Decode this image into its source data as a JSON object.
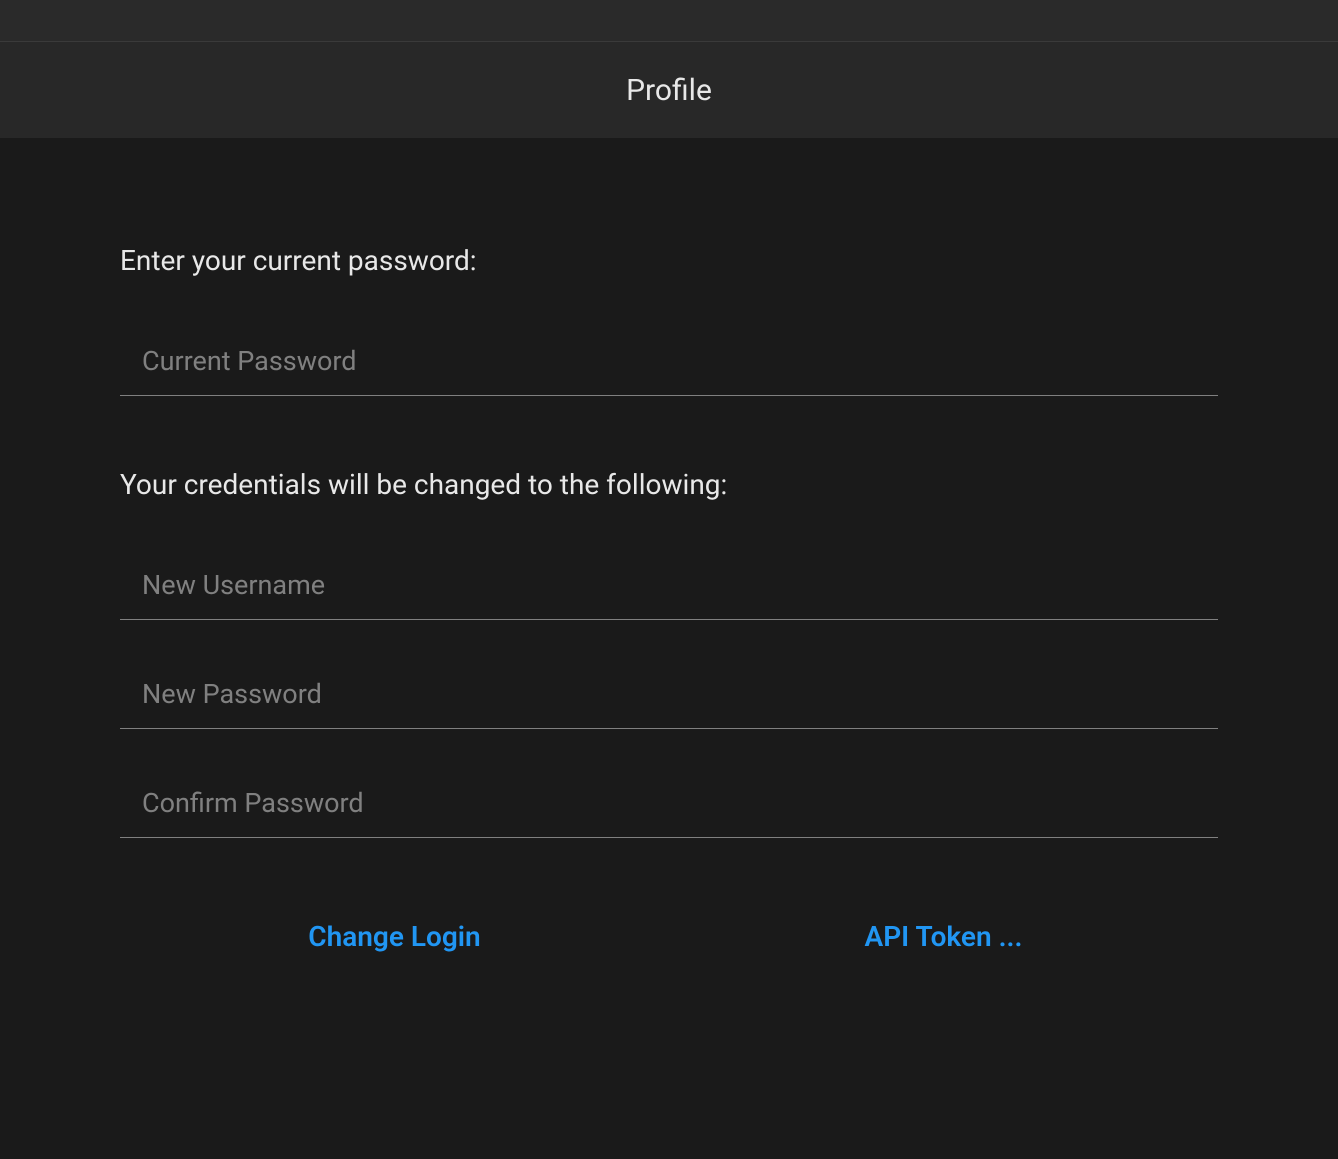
{
  "header": {
    "title": "Profile"
  },
  "form": {
    "current_password_label": "Enter your current password:",
    "current_password_placeholder": "Current Password",
    "new_credentials_label": "Your credentials will be changed to the following:",
    "new_username_placeholder": "New Username",
    "new_password_placeholder": "New Password",
    "confirm_password_placeholder": "Confirm Password"
  },
  "buttons": {
    "change_login": "Change Login",
    "api_token": "API Token ..."
  }
}
